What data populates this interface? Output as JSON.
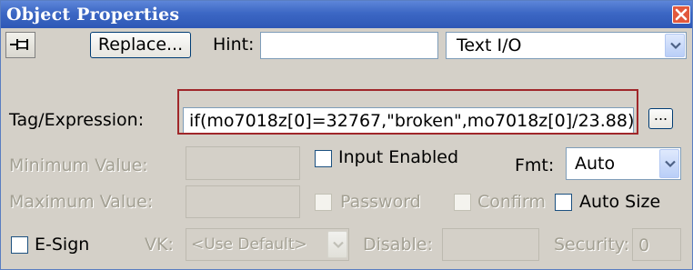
{
  "window": {
    "title": "Object Properties"
  },
  "toolbar": {
    "replace_label": "Replace...",
    "hint_label": "Hint:",
    "hint_value": "",
    "type_select_value": "Text I/O"
  },
  "tag": {
    "label": "Tag/Expression:",
    "value": "if(mo7018z[0]=32767,\"broken\",mo7018z[0]/23.88)",
    "browse_label": "..."
  },
  "minimum": {
    "label": "Minimum Value:",
    "value": ""
  },
  "maximum": {
    "label": "Maximum Value:",
    "value": ""
  },
  "input_enabled": {
    "label": "Input Enabled",
    "checked": false
  },
  "fmt": {
    "label": "Fmt:",
    "value": "Auto"
  },
  "password": {
    "label": "Password",
    "checked": false
  },
  "confirm": {
    "label": "Confirm",
    "checked": false
  },
  "auto_size": {
    "label": "Auto Size",
    "checked": false
  },
  "esign": {
    "label": "E-Sign",
    "checked": false
  },
  "vk": {
    "label": "VK:",
    "value": "<Use Default>"
  },
  "disable": {
    "label": "Disable:",
    "value": ""
  },
  "security": {
    "label": "Security:",
    "value": "0"
  },
  "colors": {
    "title_bar": "#3c67c4",
    "highlight_border": "#a0272a",
    "dialog_bg": "#d4d0c8"
  }
}
